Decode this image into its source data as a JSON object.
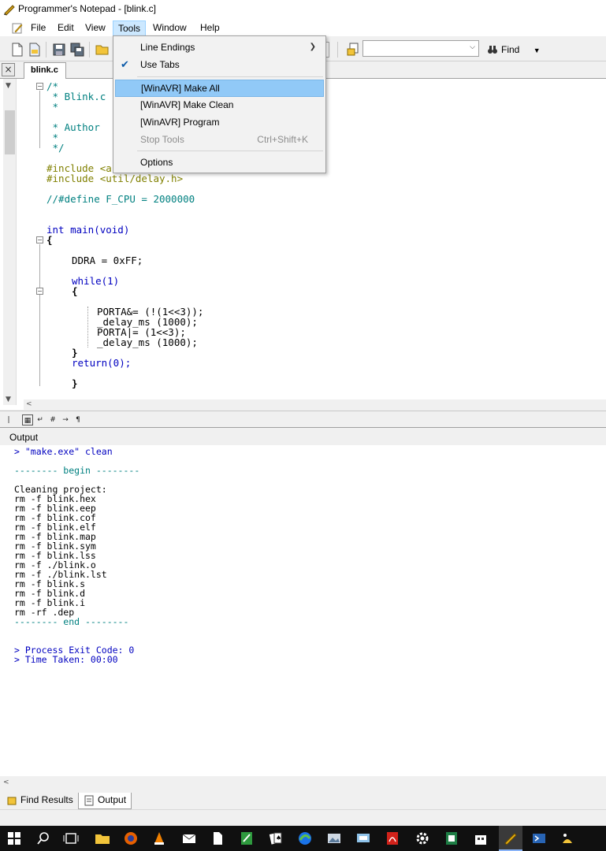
{
  "window": {
    "title": "Programmer's Notepad - [blink.c]"
  },
  "menubar": {
    "items": [
      "File",
      "Edit",
      "View",
      "Tools",
      "Window",
      "Help"
    ]
  },
  "toolbar": {
    "find_label": "Find",
    "find_value": ""
  },
  "tabs": {
    "active": "blink.c",
    "close_glyph": "×"
  },
  "tools_menu": {
    "items": [
      {
        "label": "Line Endings",
        "has_submenu": true
      },
      {
        "label": "Use Tabs",
        "checked": true
      },
      {
        "label": "[WinAVR] Make All",
        "highlighted": true
      },
      {
        "label": "[WinAVR] Make Clean"
      },
      {
        "label": "[WinAVR] Program"
      },
      {
        "label": "Stop Tools",
        "shortcut": "Ctrl+Shift+K",
        "disabled": true
      },
      {
        "label": "Options"
      }
    ]
  },
  "editor": {
    "lines": [
      "/*",
      " * Blink.c",
      " *",
      " * Author",
      " *",
      " */",
      "#include <a",
      "#include <util/delay.h>",
      "//#define F_CPU = 2000000",
      "int main(void)",
      "{",
      "DDRA = 0xFF;",
      "while(1)",
      "{",
      "PORTA&= (!(1<<3));",
      "_delay_ms (1000);",
      "PORTA|= (1<<3);",
      "_delay_ms (1000);",
      "}",
      "return(0);",
      "}"
    ]
  },
  "output": {
    "panel_title": "Output",
    "lines": [
      "> \"make.exe\" clean",
      "",
      "-------- begin --------",
      "",
      "Cleaning project:",
      "rm -f blink.hex",
      "rm -f blink.eep",
      "rm -f blink.cof",
      "rm -f blink.elf",
      "rm -f blink.map",
      "rm -f blink.sym",
      "rm -f blink.lss",
      "rm -f ./blink.o",
      "rm -f ./blink.lst",
      "rm -f blink.s",
      "rm -f blink.d",
      "rm -f blink.i",
      "rm -rf .dep",
      "-------- end --------",
      "",
      "",
      "> Process Exit Code: 0",
      "> Time Taken: 00:00"
    ]
  },
  "bottom_tabs": [
    "Find Results",
    "Output"
  ],
  "colors": {
    "comment": "#008080",
    "keyword": "#0000c0",
    "preprocessor": "#808000",
    "menu_highlight": "#91c9f7"
  }
}
